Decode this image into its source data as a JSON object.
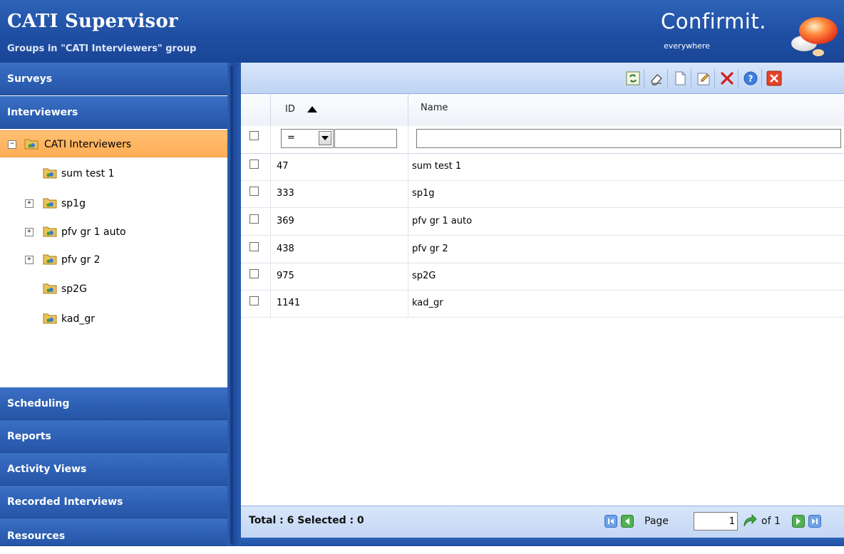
{
  "header": {
    "title": "CATI Supervisor",
    "subtitle": "Groups in \"CATI Interviewers\" group",
    "logo_text": "Confirmit.",
    "logo_tagline": "everywhere"
  },
  "sidebar": {
    "sections_top": [
      {
        "label": "Surveys"
      },
      {
        "label": "Interviewers"
      }
    ],
    "tree": [
      {
        "label": "CATI Interviewers",
        "expander": "−",
        "selected": true
      },
      {
        "label": "sum test 1",
        "expander": ""
      },
      {
        "label": "sp1g",
        "expander": "+"
      },
      {
        "label": "pfv gr 1 auto",
        "expander": "+"
      },
      {
        "label": "pfv gr 2",
        "expander": "+"
      },
      {
        "label": "sp2G",
        "expander": ""
      },
      {
        "label": "kad_gr",
        "expander": ""
      }
    ],
    "sections_bottom": [
      {
        "label": "Scheduling"
      },
      {
        "label": "Reports"
      },
      {
        "label": "Activity Views"
      },
      {
        "label": "Recorded Interviews"
      },
      {
        "label": "Resources"
      }
    ]
  },
  "toolbar": {
    "icons": [
      "refresh-icon",
      "eraser-icon",
      "new-document-icon",
      "edit-icon",
      "delete-icon",
      "help-icon",
      "close-icon"
    ]
  },
  "grid": {
    "columns": {
      "id": "ID",
      "name": "Name"
    },
    "sort": {
      "column": "id",
      "direction": "ascending"
    },
    "filter": {
      "operator": "=",
      "id_value": "",
      "name_value": ""
    },
    "rows": [
      {
        "id": "47",
        "name": "sum test 1"
      },
      {
        "id": "333",
        "name": "sp1g"
      },
      {
        "id": "369",
        "name": "pfv gr 1 auto"
      },
      {
        "id": "438",
        "name": "pfv gr 2"
      },
      {
        "id": "975",
        "name": "sp2G"
      },
      {
        "id": "1141",
        "name": "kad_gr"
      }
    ]
  },
  "footer": {
    "total_text": "Total : 6 Selected : 0",
    "page_label": "Page",
    "page_value": "1",
    "of_text": "of 1"
  },
  "colors": {
    "header_blue": "#2d63b8",
    "selected_orange": "#ffb35d",
    "toolbar_light_blue": "#cfe0f8"
  }
}
